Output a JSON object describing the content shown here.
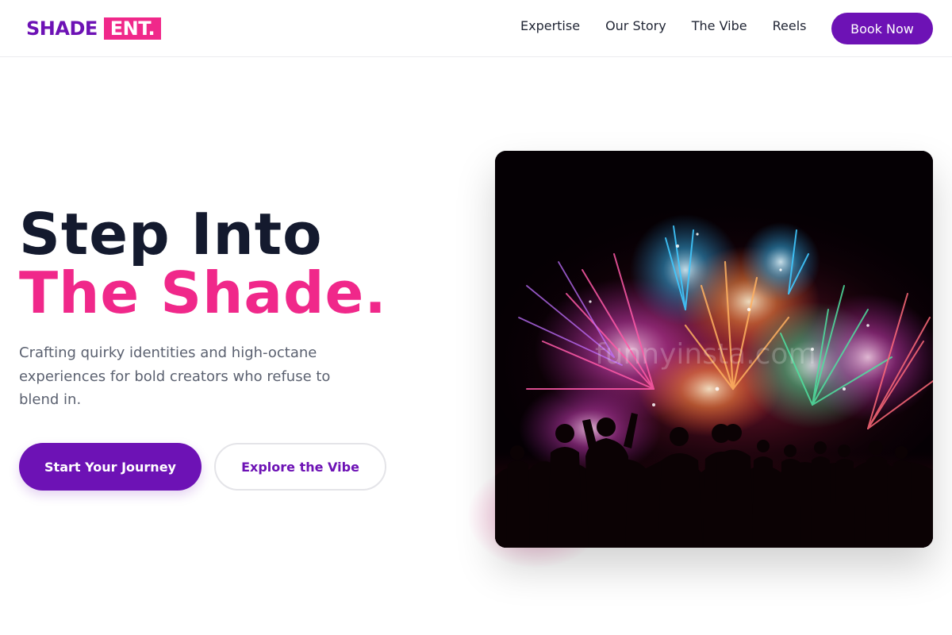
{
  "brand": {
    "name_main": "SHADE",
    "name_box": "ENT.",
    "colors": {
      "primary": "#6d12b5",
      "accent": "#f0288a",
      "heading": "#141a2e",
      "body": "#5b6170"
    }
  },
  "nav": {
    "items": [
      {
        "label": "Expertise"
      },
      {
        "label": "Our Story"
      },
      {
        "label": "The Vibe"
      },
      {
        "label": "Reels"
      }
    ],
    "cta_label": "Book Now"
  },
  "hero": {
    "title_line1": "Step Into",
    "title_line2": "The Shade.",
    "subtitle": "Crafting quirky identities and high-octane experiences for bold creators who refuse to blend in.",
    "primary_button": "Start Your Journey",
    "secondary_button": "Explore the Vibe",
    "image": {
      "subject": "fireworks-over-crowd-silhouettes",
      "watermark": "funnyinsta.com"
    }
  }
}
